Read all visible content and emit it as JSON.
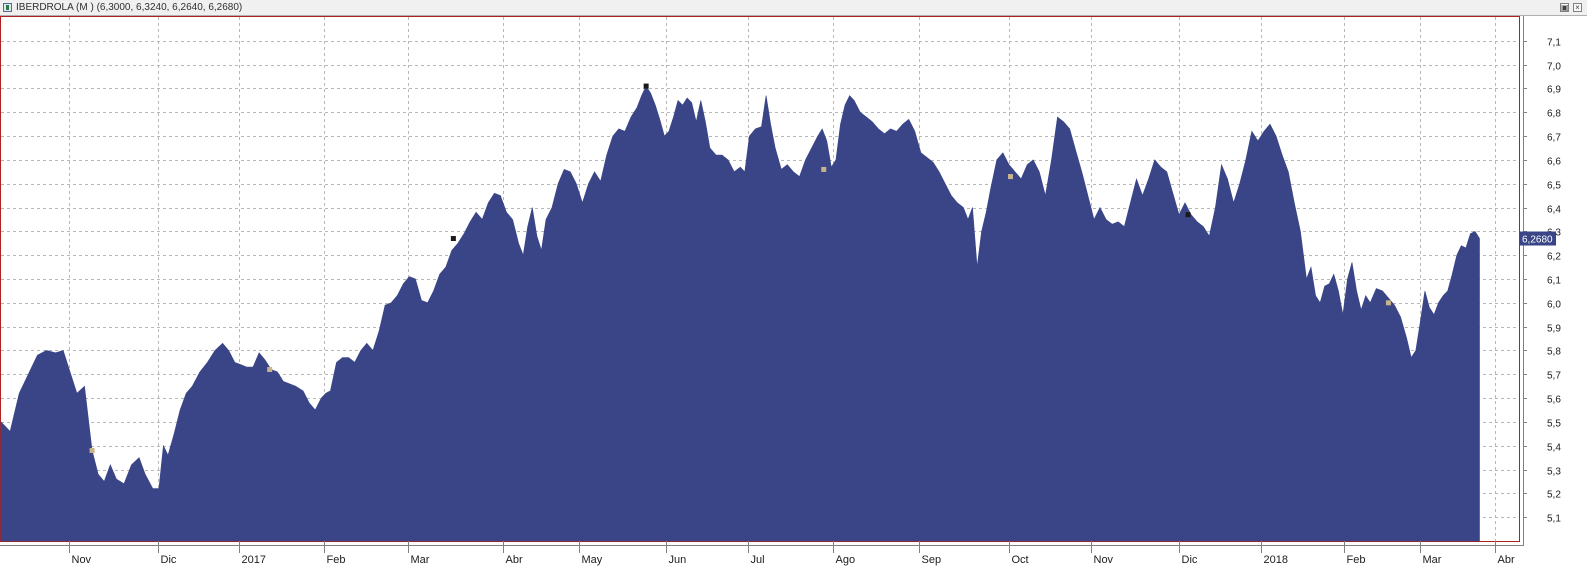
{
  "window": {
    "title": "IBERDROLA (M ) (6,3000, 6,3240, 6,2640, 6,2680)",
    "restore_glyph": "▣",
    "close_glyph": "×"
  },
  "chart_data": {
    "type": "area",
    "title": "IBERDROLA (M ) (6,3000, 6,3240, 6,2640, 6,2680)",
    "fill_color": "#3a4587",
    "grid": true,
    "last_value_label": "6,2680",
    "ylim": [
      5.0,
      7.2
    ],
    "y_ticks": [
      "5,1",
      "5,2",
      "5,3",
      "5,4",
      "5,5",
      "5,6",
      "5,7",
      "5,8",
      "5,9",
      "6,0",
      "6,1",
      "6,2",
      "6,3",
      "6,4",
      "6,5",
      "6,6",
      "6,7",
      "6,8",
      "6,9",
      "7,0",
      "7,1"
    ],
    "x_ticks": [
      "Nov",
      "Dic",
      "2017",
      "Feb",
      "Mar",
      "Abr",
      "May",
      "Jun",
      "Jul",
      "Ago",
      "Sep",
      "Oct",
      "Nov",
      "Dic",
      "2018",
      "Feb",
      "Mar",
      "Abr"
    ],
    "x_tick_pos": [
      0.045,
      0.1035,
      0.157,
      0.213,
      0.268,
      0.331,
      0.381,
      0.438,
      0.492,
      0.548,
      0.605,
      0.664,
      0.718,
      0.776,
      0.83,
      0.885,
      0.935,
      0.984
    ],
    "series": [
      {
        "values": [
          [
            0.0,
            5.5
          ],
          [
            0.006,
            5.46
          ],
          [
            0.012,
            5.62
          ],
          [
            0.018,
            5.7
          ],
          [
            0.024,
            5.78
          ],
          [
            0.03,
            5.8
          ],
          [
            0.036,
            5.79
          ],
          [
            0.041,
            5.8
          ],
          [
            0.046,
            5.7
          ],
          [
            0.05,
            5.62
          ],
          [
            0.055,
            5.65
          ],
          [
            0.06,
            5.38
          ],
          [
            0.064,
            5.28
          ],
          [
            0.068,
            5.25
          ],
          [
            0.072,
            5.32
          ],
          [
            0.076,
            5.26
          ],
          [
            0.081,
            5.24
          ],
          [
            0.086,
            5.32
          ],
          [
            0.091,
            5.35
          ],
          [
            0.095,
            5.28
          ],
          [
            0.1,
            5.22
          ],
          [
            0.104,
            5.22
          ],
          [
            0.107,
            5.4
          ],
          [
            0.11,
            5.36
          ],
          [
            0.114,
            5.45
          ],
          [
            0.118,
            5.55
          ],
          [
            0.122,
            5.62
          ],
          [
            0.126,
            5.65
          ],
          [
            0.131,
            5.71
          ],
          [
            0.136,
            5.75
          ],
          [
            0.141,
            5.8
          ],
          [
            0.146,
            5.83
          ],
          [
            0.15,
            5.8
          ],
          [
            0.154,
            5.75
          ],
          [
            0.158,
            5.74
          ],
          [
            0.162,
            5.73
          ],
          [
            0.166,
            5.73
          ],
          [
            0.17,
            5.79
          ],
          [
            0.174,
            5.76
          ],
          [
            0.178,
            5.72
          ],
          [
            0.182,
            5.71
          ],
          [
            0.186,
            5.67
          ],
          [
            0.19,
            5.66
          ],
          [
            0.194,
            5.65
          ],
          [
            0.199,
            5.63
          ],
          [
            0.203,
            5.58
          ],
          [
            0.207,
            5.55
          ],
          [
            0.211,
            5.6
          ],
          [
            0.214,
            5.62
          ],
          [
            0.217,
            5.63
          ],
          [
            0.221,
            5.75
          ],
          [
            0.225,
            5.77
          ],
          [
            0.229,
            5.77
          ],
          [
            0.233,
            5.75
          ],
          [
            0.237,
            5.8
          ],
          [
            0.241,
            5.83
          ],
          [
            0.245,
            5.8
          ],
          [
            0.249,
            5.88
          ],
          [
            0.253,
            5.99
          ],
          [
            0.257,
            6.0
          ],
          [
            0.261,
            6.03
          ],
          [
            0.265,
            6.08
          ],
          [
            0.269,
            6.11
          ],
          [
            0.273,
            6.1
          ],
          [
            0.277,
            6.01
          ],
          [
            0.281,
            6.0
          ],
          [
            0.285,
            6.05
          ],
          [
            0.289,
            6.12
          ],
          [
            0.293,
            6.15
          ],
          [
            0.297,
            6.22
          ],
          [
            0.301,
            6.25
          ],
          [
            0.305,
            6.29
          ],
          [
            0.309,
            6.34
          ],
          [
            0.313,
            6.38
          ],
          [
            0.317,
            6.35
          ],
          [
            0.321,
            6.42
          ],
          [
            0.325,
            6.46
          ],
          [
            0.329,
            6.45
          ],
          [
            0.333,
            6.38
          ],
          [
            0.337,
            6.35
          ],
          [
            0.341,
            6.25
          ],
          [
            0.344,
            6.2
          ],
          [
            0.347,
            6.32
          ],
          [
            0.35,
            6.4
          ],
          [
            0.353,
            6.28
          ],
          [
            0.356,
            6.22
          ],
          [
            0.359,
            6.35
          ],
          [
            0.363,
            6.4
          ],
          [
            0.367,
            6.5
          ],
          [
            0.371,
            6.56
          ],
          [
            0.375,
            6.55
          ],
          [
            0.379,
            6.5
          ],
          [
            0.383,
            6.42
          ],
          [
            0.387,
            6.5
          ],
          [
            0.391,
            6.55
          ],
          [
            0.395,
            6.51
          ],
          [
            0.399,
            6.62
          ],
          [
            0.403,
            6.7
          ],
          [
            0.407,
            6.73
          ],
          [
            0.411,
            6.72
          ],
          [
            0.415,
            6.78
          ],
          [
            0.419,
            6.82
          ],
          [
            0.422,
            6.87
          ],
          [
            0.425,
            6.91
          ],
          [
            0.428,
            6.88
          ],
          [
            0.431,
            6.83
          ],
          [
            0.434,
            6.77
          ],
          [
            0.437,
            6.7
          ],
          [
            0.44,
            6.72
          ],
          [
            0.443,
            6.78
          ],
          [
            0.446,
            6.85
          ],
          [
            0.449,
            6.83
          ],
          [
            0.452,
            6.86
          ],
          [
            0.455,
            6.84
          ],
          [
            0.458,
            6.76
          ],
          [
            0.461,
            6.85
          ],
          [
            0.464,
            6.76
          ],
          [
            0.467,
            6.65
          ],
          [
            0.471,
            6.62
          ],
          [
            0.475,
            6.62
          ],
          [
            0.479,
            6.6
          ],
          [
            0.483,
            6.55
          ],
          [
            0.487,
            6.57
          ],
          [
            0.49,
            6.55
          ],
          [
            0.493,
            6.7
          ],
          [
            0.497,
            6.73
          ],
          [
            0.501,
            6.74
          ],
          [
            0.504,
            6.87
          ],
          [
            0.507,
            6.75
          ],
          [
            0.51,
            6.65
          ],
          [
            0.514,
            6.56
          ],
          [
            0.518,
            6.58
          ],
          [
            0.522,
            6.55
          ],
          [
            0.526,
            6.53
          ],
          [
            0.53,
            6.6
          ],
          [
            0.534,
            6.65
          ],
          [
            0.538,
            6.7
          ],
          [
            0.541,
            6.73
          ],
          [
            0.544,
            6.68
          ],
          [
            0.547,
            6.57
          ],
          [
            0.55,
            6.6
          ],
          [
            0.553,
            6.75
          ],
          [
            0.556,
            6.83
          ],
          [
            0.559,
            6.87
          ],
          [
            0.562,
            6.85
          ],
          [
            0.566,
            6.8
          ],
          [
            0.57,
            6.78
          ],
          [
            0.574,
            6.76
          ],
          [
            0.578,
            6.73
          ],
          [
            0.582,
            6.71
          ],
          [
            0.586,
            6.73
          ],
          [
            0.59,
            6.72
          ],
          [
            0.594,
            6.75
          ],
          [
            0.598,
            6.77
          ],
          [
            0.602,
            6.72
          ],
          [
            0.606,
            6.63
          ],
          [
            0.61,
            6.61
          ],
          [
            0.614,
            6.59
          ],
          [
            0.618,
            6.55
          ],
          [
            0.622,
            6.5
          ],
          [
            0.626,
            6.45
          ],
          [
            0.63,
            6.42
          ],
          [
            0.634,
            6.4
          ],
          [
            0.637,
            6.35
          ],
          [
            0.64,
            6.4
          ],
          [
            0.643,
            6.15
          ],
          [
            0.646,
            6.3
          ],
          [
            0.649,
            6.38
          ],
          [
            0.652,
            6.48
          ],
          [
            0.656,
            6.6
          ],
          [
            0.66,
            6.63
          ],
          [
            0.664,
            6.58
          ],
          [
            0.668,
            6.55
          ],
          [
            0.672,
            6.52
          ],
          [
            0.676,
            6.58
          ],
          [
            0.68,
            6.6
          ],
          [
            0.684,
            6.55
          ],
          [
            0.688,
            6.45
          ],
          [
            0.692,
            6.6
          ],
          [
            0.696,
            6.78
          ],
          [
            0.7,
            6.76
          ],
          [
            0.704,
            6.73
          ],
          [
            0.708,
            6.64
          ],
          [
            0.712,
            6.55
          ],
          [
            0.716,
            6.45
          ],
          [
            0.72,
            6.35
          ],
          [
            0.724,
            6.4
          ],
          [
            0.728,
            6.35
          ],
          [
            0.732,
            6.33
          ],
          [
            0.736,
            6.34
          ],
          [
            0.74,
            6.32
          ],
          [
            0.744,
            6.42
          ],
          [
            0.748,
            6.52
          ],
          [
            0.752,
            6.45
          ],
          [
            0.756,
            6.52
          ],
          [
            0.76,
            6.6
          ],
          [
            0.764,
            6.57
          ],
          [
            0.768,
            6.55
          ],
          [
            0.772,
            6.46
          ],
          [
            0.776,
            6.37
          ],
          [
            0.78,
            6.42
          ],
          [
            0.784,
            6.37
          ],
          [
            0.788,
            6.34
          ],
          [
            0.792,
            6.32
          ],
          [
            0.796,
            6.28
          ],
          [
            0.8,
            6.4
          ],
          [
            0.804,
            6.58
          ],
          [
            0.808,
            6.52
          ],
          [
            0.812,
            6.42
          ],
          [
            0.816,
            6.5
          ],
          [
            0.82,
            6.6
          ],
          [
            0.824,
            6.72
          ],
          [
            0.828,
            6.68
          ],
          [
            0.832,
            6.72
          ],
          [
            0.836,
            6.75
          ],
          [
            0.84,
            6.7
          ],
          [
            0.844,
            6.62
          ],
          [
            0.848,
            6.55
          ],
          [
            0.852,
            6.42
          ],
          [
            0.856,
            6.3
          ],
          [
            0.86,
            6.1
          ],
          [
            0.863,
            6.15
          ],
          [
            0.866,
            6.03
          ],
          [
            0.869,
            6.0
          ],
          [
            0.872,
            6.07
          ],
          [
            0.875,
            6.08
          ],
          [
            0.878,
            6.12
          ],
          [
            0.881,
            6.05
          ],
          [
            0.884,
            5.95
          ],
          [
            0.887,
            6.1
          ],
          [
            0.89,
            6.17
          ],
          [
            0.893,
            6.05
          ],
          [
            0.896,
            5.97
          ],
          [
            0.899,
            6.03
          ],
          [
            0.902,
            6.0
          ],
          [
            0.906,
            6.06
          ],
          [
            0.91,
            6.05
          ],
          [
            0.914,
            6.02
          ],
          [
            0.918,
            5.99
          ],
          [
            0.922,
            5.94
          ],
          [
            0.926,
            5.85
          ],
          [
            0.929,
            5.77
          ],
          [
            0.932,
            5.8
          ],
          [
            0.935,
            5.92
          ],
          [
            0.938,
            6.05
          ],
          [
            0.941,
            5.98
          ],
          [
            0.944,
            5.95
          ],
          [
            0.947,
            6.0
          ],
          [
            0.95,
            6.03
          ],
          [
            0.953,
            6.05
          ],
          [
            0.956,
            6.12
          ],
          [
            0.959,
            6.2
          ],
          [
            0.962,
            6.24
          ],
          [
            0.965,
            6.23
          ],
          [
            0.968,
            6.29
          ],
          [
            0.971,
            6.3
          ],
          [
            0.974,
            6.27
          ]
        ]
      }
    ],
    "markers": [
      {
        "x": 0.06,
        "y": 5.38,
        "color": "#c8b48c"
      },
      {
        "x": 0.177,
        "y": 5.72,
        "color": "#c8b48c"
      },
      {
        "x": 0.298,
        "y": 6.27,
        "color": "#1a1a1a"
      },
      {
        "x": 0.425,
        "y": 6.91,
        "color": "#1a1a1a"
      },
      {
        "x": 0.542,
        "y": 6.56,
        "color": "#c8b48c"
      },
      {
        "x": 0.665,
        "y": 6.53,
        "color": "#c8b48c"
      },
      {
        "x": 0.782,
        "y": 6.37,
        "color": "#1a1a1a"
      },
      {
        "x": 0.914,
        "y": 6.0,
        "color": "#c8b48c"
      }
    ]
  }
}
